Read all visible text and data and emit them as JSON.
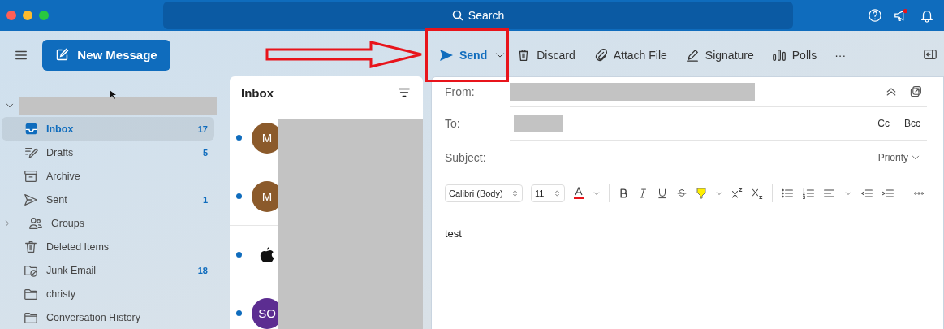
{
  "title_bar": {
    "search_placeholder": "Search"
  },
  "toolbar": {
    "new_message": "New Message",
    "actions": [
      {
        "kind": "send",
        "label": "Send",
        "highlighted": true
      },
      {
        "kind": "discard",
        "label": "Discard",
        "highlighted": false
      },
      {
        "kind": "attach",
        "label": "Attach File",
        "highlighted": false
      },
      {
        "kind": "signature",
        "label": "Signature",
        "highlighted": false
      },
      {
        "kind": "polls",
        "label": "Polls",
        "highlighted": false
      },
      {
        "kind": "more",
        "label": "···",
        "highlighted": false
      }
    ]
  },
  "sidebar": {
    "account": {
      "expanded": true
    },
    "items": [
      {
        "kind": "inbox",
        "label": "Inbox",
        "count": "17",
        "selected": true,
        "expandable": false
      },
      {
        "kind": "drafts",
        "label": "Drafts",
        "count": "5",
        "selected": false,
        "expandable": false
      },
      {
        "kind": "archive",
        "label": "Archive",
        "selected": false,
        "expandable": false
      },
      {
        "kind": "sent",
        "label": "Sent",
        "count": "1",
        "selected": false,
        "expandable": false
      },
      {
        "kind": "groups",
        "label": "Groups",
        "selected": false,
        "expandable": true
      },
      {
        "kind": "trash",
        "label": "Deleted Items",
        "selected": false,
        "expandable": false
      },
      {
        "kind": "junk",
        "label": "Junk Email",
        "count": "18",
        "selected": false,
        "expandable": false
      },
      {
        "kind": "folder",
        "label": "christy",
        "selected": false,
        "expandable": false
      },
      {
        "kind": "folder",
        "label": "Conversation History",
        "selected": false,
        "expandable": false
      }
    ]
  },
  "message_list": {
    "title": "Inbox",
    "messages": [
      {
        "kind": "initials",
        "initials": "M",
        "color": "#8b5a2b",
        "unread": true
      },
      {
        "kind": "initials",
        "initials": "M",
        "color": "#8b5a2b",
        "unread": true
      },
      {
        "kind": "logo",
        "unread": true
      },
      {
        "kind": "initials",
        "initials": "SO",
        "color": "#5c2d91",
        "unread": true
      }
    ]
  },
  "compose": {
    "from_label": "From:",
    "to_label": "To:",
    "cc": "Cc",
    "bcc": "Bcc",
    "subject_label": "Subject:",
    "priority": "Priority",
    "font": "Calibri (Body)",
    "size": "11",
    "body": "test"
  }
}
